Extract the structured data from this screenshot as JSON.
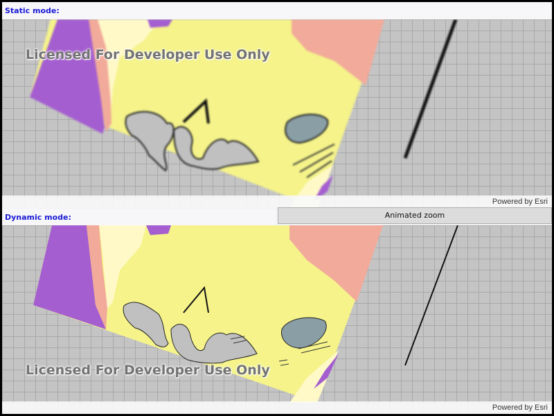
{
  "static_panel": {
    "label": "Static mode:",
    "watermark": "Licensed For Developer Use Only",
    "attribution": "Powered by Esri"
  },
  "dynamic_panel": {
    "label": "Dynamic mode:",
    "zoom_button_label": "Animated zoom",
    "watermark": "Licensed For Developer Use Only",
    "attribution": "Powered by Esri"
  },
  "colors": {
    "label_blue": "#1a1ad6",
    "basemap_gray": "#c4c4c4",
    "land_yellow": "#f5f38a",
    "purple": "#a45ed0",
    "salmon": "#f2aa9a",
    "cream": "#fff9c8",
    "water_gray": "#c0c0c0",
    "lake_blue": "#8a9ea6"
  }
}
